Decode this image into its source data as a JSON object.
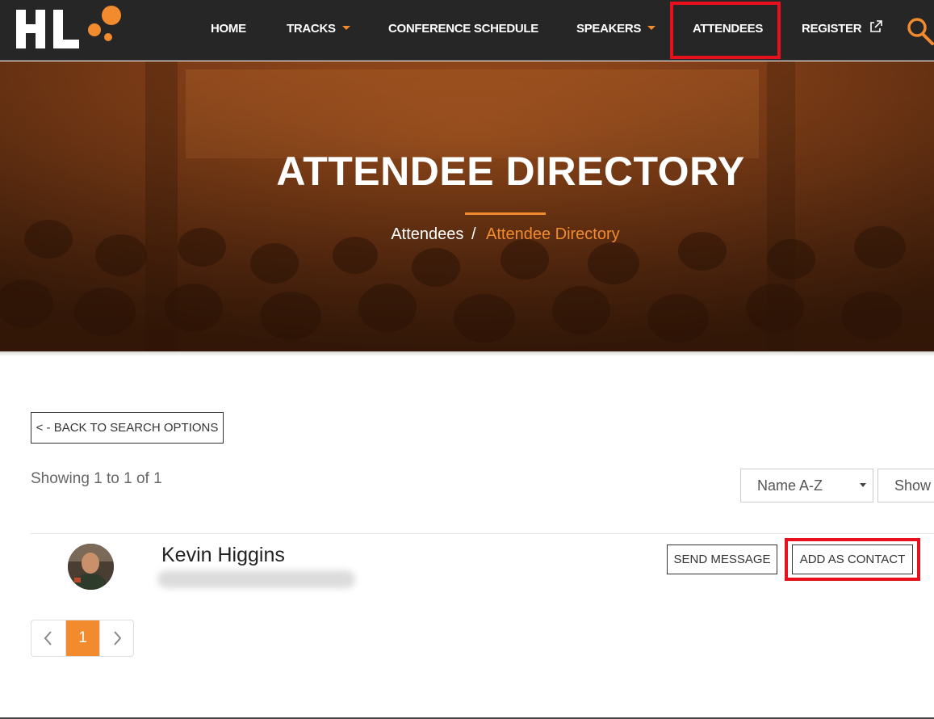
{
  "nav": {
    "logo_text": "HL",
    "items": [
      {
        "label": "HOME"
      },
      {
        "label": "TRACKS"
      },
      {
        "label": "CONFERENCE SCHEDULE"
      },
      {
        "label": "SPEAKERS"
      },
      {
        "label": "ATTENDEES"
      },
      {
        "label": "REGISTER"
      }
    ]
  },
  "hero": {
    "title": "ATTENDEE DIRECTORY",
    "breadcrumb": {
      "parent": "Attendees",
      "separator": "/",
      "current": "Attendee Directory"
    }
  },
  "main": {
    "back_button": "< - BACK TO SEARCH OPTIONS",
    "showing": "Showing 1 to 1 of 1",
    "sort_select": "Name A-Z",
    "show_select": "Show ..."
  },
  "attendee": {
    "name": "Kevin Higgins",
    "send_message": "SEND MESSAGE",
    "add_contact": "ADD AS CONTACT"
  },
  "pagination": {
    "current_page": "1"
  },
  "colors": {
    "accent": "#f28a2e",
    "nav_bg": "#262626",
    "highlight": "#e8101c"
  }
}
